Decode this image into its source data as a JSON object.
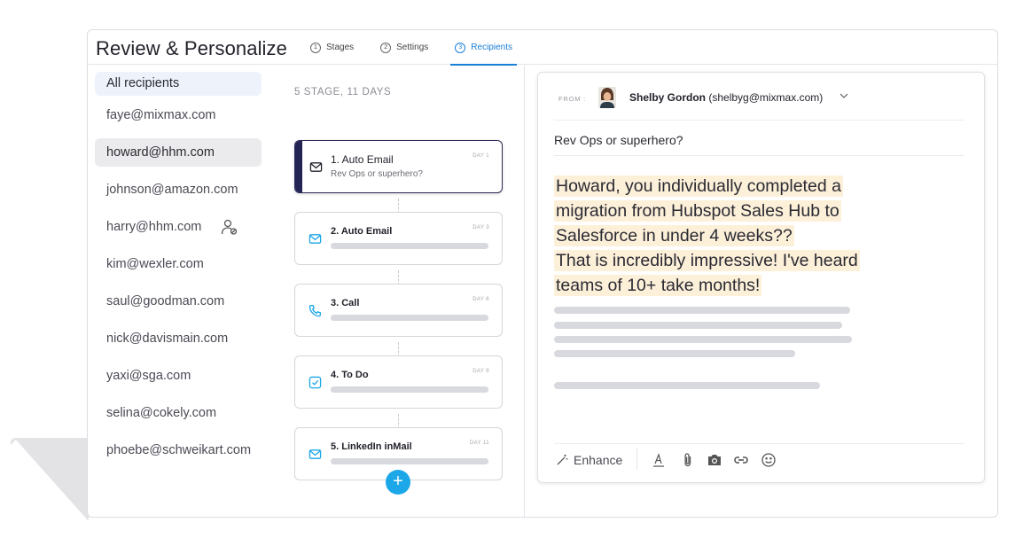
{
  "header": {
    "title": "Review & Personalize",
    "tabs": [
      {
        "num": "1",
        "label": "Stages"
      },
      {
        "num": "2",
        "label": "Settings"
      },
      {
        "num": "3",
        "label": "Recipients"
      }
    ]
  },
  "recipients": {
    "all_label": "All recipients",
    "items": [
      "faye@mixmax.com",
      "howard@hhm.com",
      "johnson@amazon.com",
      "harry@hhm.com",
      "kim@wexler.com",
      "saul@goodman.com",
      "nick@davismain.com",
      "yaxi@sga.com",
      "selina@cokely.com",
      "phoebe@schweikart.com"
    ]
  },
  "stages": {
    "heading": "5 STAGE, 11 DAYS",
    "items": [
      {
        "title": "1. Auto Email",
        "subtitle": "Rev Ops or superhero?",
        "day": "DAY 1",
        "icon": "envelope-icon"
      },
      {
        "title": "2. Auto Email",
        "day": "DAY 3",
        "icon": "envelope-icon"
      },
      {
        "title": "3. Call",
        "day": "DAY 6",
        "icon": "phone-icon"
      },
      {
        "title": "4. To Do",
        "day": "DAY 9",
        "icon": "checkbox-icon"
      },
      {
        "title": "5. LinkedIn inMail",
        "day": "DAY 11",
        "icon": "envelope-icon"
      }
    ],
    "add_label": "+"
  },
  "email": {
    "from_label": "FROM :",
    "sender_name": "Shelby Gordon",
    "sender_email": "(shelbyg@mixmax.com)",
    "subject": "Rev Ops or superhero?",
    "body_lines": [
      "Howard, you individually completed a",
      "migration from Hubspot Sales Hub to",
      "Salesforce in under 4 weeks??",
      "That is incredibly impressive! I've heard",
      "teams of 10+ take months!"
    ],
    "toolbar": {
      "enhance_label": "Enhance"
    }
  },
  "colors": {
    "accent": "#1a7fd6",
    "add_button": "#1ba7e8",
    "active_stage_bar": "#232354",
    "highlight": "#fdf0d9"
  }
}
